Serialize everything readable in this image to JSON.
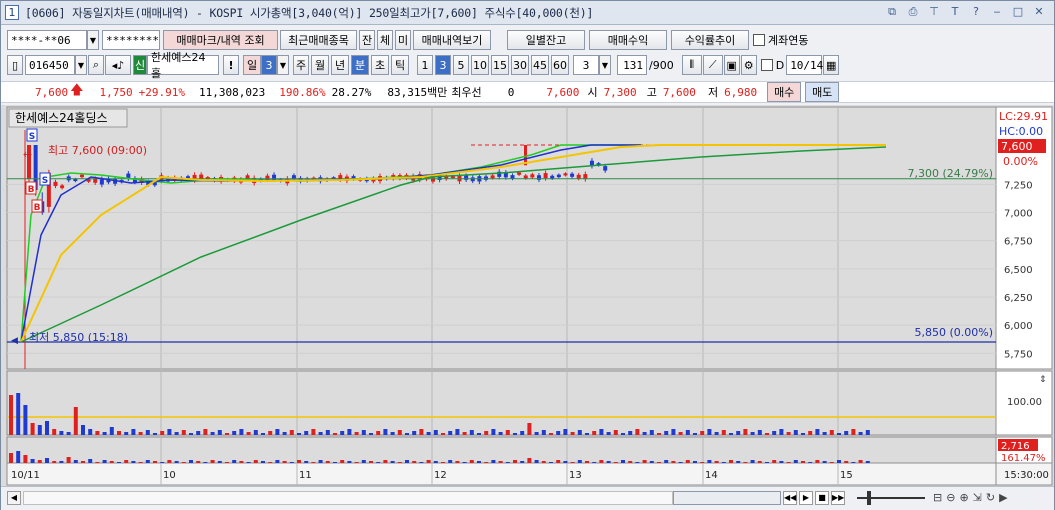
{
  "window": {
    "number": "1",
    "title": "[0606] 자동일지차트(매매내역) - KOSPI 시가총액[3,040(억)] 250일최고가[7,600] 주식수[40,000(천)]"
  },
  "toolbar1": {
    "account": "****-**06",
    "password": "********",
    "trade_mark_btn": "매매마크/내역 조회",
    "recent_items_btn": "최근매매종목",
    "jan_btn": "잔",
    "che_btn": "체",
    "mi_btn": "미",
    "trade_view_btn": "매매내역보기",
    "daily_balance_btn": "일별잔고",
    "trade_profit_btn": "매매수익",
    "return_trend_btn": "수익률추이",
    "account_link_label": "계좌연동"
  },
  "toolbar2": {
    "code": "016450",
    "shin": "신",
    "stock_name": "한세예스24홀",
    "period_day": "일",
    "period_day_value": "3",
    "period_week": "주",
    "period_month": "월",
    "period_year": "년",
    "period_min": "분",
    "period_sec": "초",
    "period_tick": "틱",
    "intervals": [
      "1",
      "3",
      "5",
      "10",
      "15",
      "30",
      "45",
      "60"
    ],
    "interval_value": "3",
    "count": "131",
    "count_max": "/900",
    "d_label": "D",
    "date": "10/14"
  },
  "quote": {
    "price": "7,600",
    "change": "1,750",
    "change_pct": "+29.91%",
    "volume": "11,308,023",
    "volume_ratio": "190.86%",
    "turnover": "28.27%",
    "amount": "83,315백만",
    "best_label": "최우선",
    "best_value": "0",
    "best_price": "7,600",
    "open_label": "시",
    "open": "7,300",
    "high_label": "고",
    "high": "7,600",
    "low_label": "저",
    "low": "6,980",
    "buy_btn": "매수",
    "sell_btn": "매도"
  },
  "chart": {
    "stock_title": "한세예스24홀딩스",
    "high_annotation": "최고 7,600 (09:00)",
    "low_annotation": "최저 5,850 (15:18)",
    "ref_line_label": "7,300 (24.79%)",
    "low_line_label": "5,850 (0.00%)",
    "lc_label": "LC:29.91",
    "hc_label": "HC:0.00",
    "price_tag": "7,600",
    "price_pct": "0.00%",
    "y_ticks": [
      "7,250",
      "7,000",
      "6,750",
      "6,500",
      "6,250",
      "6,000",
      "5,750"
    ],
    "volume_tick": "100.00",
    "volume2_tag": "2,716",
    "volume2_pct": "161.47%",
    "x_labels": [
      "10/11",
      "10",
      "11",
      "12",
      "13",
      "14",
      "15"
    ],
    "time_label": "15:30:00",
    "colors": {
      "ma5": "#22cc22",
      "ma10": "#1f2fd0",
      "ma20": "#f5c400",
      "ma60": "#1b9a3a",
      "up": "#e0201e",
      "down": "#1f3ad0",
      "low_line": "#1f2fa8",
      "ref_line": "#2f8a4a"
    }
  },
  "chart_data": {
    "type": "line",
    "ylim": [
      5700,
      7650
    ],
    "series": [
      {
        "x": [
          0.0,
          0.02,
          0.06,
          0.1,
          0.15,
          0.2,
          0.25,
          0.3,
          0.35,
          0.4,
          0.45,
          0.5,
          0.54,
          0.58,
          0.62,
          0.7,
          0.8,
          0.9,
          1.0
        ],
        "values": [
          5850,
          7500,
          7350,
          7320,
          7300,
          7310,
          7300,
          7300,
          7310,
          7320,
          7330,
          7340,
          7360,
          7380,
          7400,
          7420,
          7440,
          7460,
          7500
        ]
      }
    ]
  }
}
